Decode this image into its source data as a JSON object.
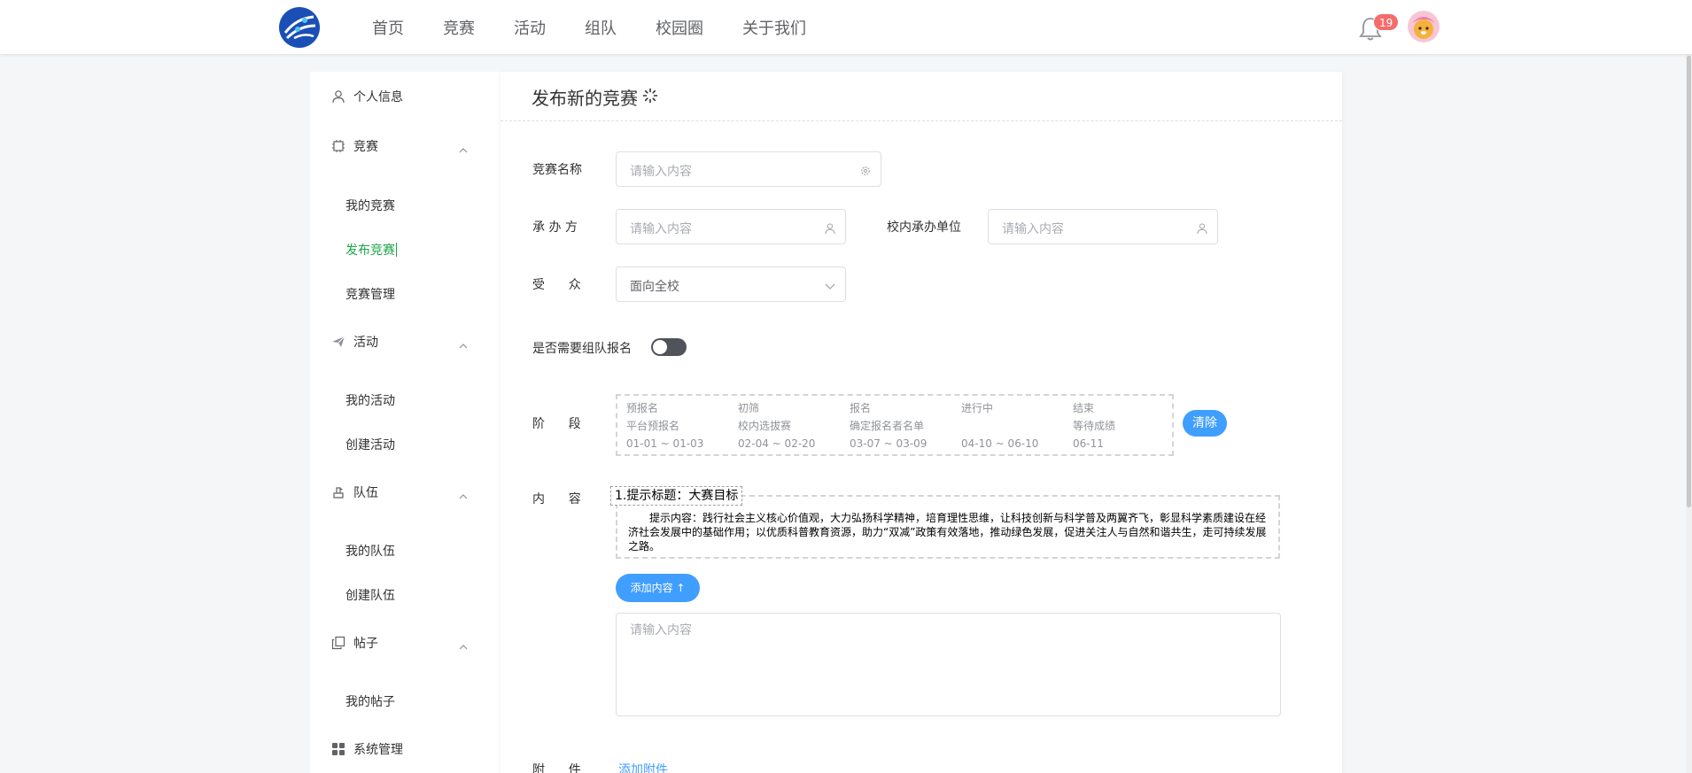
{
  "header": {
    "nav": [
      "首页",
      "竞赛",
      "活动",
      "组队",
      "校园圈",
      "关于我们"
    ],
    "notification_count": "19"
  },
  "sidebar": {
    "profile": "个人信息",
    "competition": {
      "label": "竞赛",
      "items": [
        "我的竞赛",
        "发布竞赛",
        "竞赛管理"
      ],
      "active": "发布竞赛"
    },
    "activity": {
      "label": "活动",
      "items": [
        "我的活动",
        "创建活动"
      ]
    },
    "team": {
      "label": "队伍",
      "items": [
        "我的队伍",
        "创建队伍"
      ]
    },
    "post": {
      "label": "帖子",
      "items": [
        "我的帖子"
      ]
    },
    "system": "系统管理"
  },
  "main": {
    "title": "发布新的竞赛",
    "form": {
      "name_label": "竞赛名称",
      "name_placeholder": "请输入内容",
      "organizer_label": "承 办 方",
      "organizer_placeholder": "请输入内容",
      "unit_label": "校内承办单位",
      "unit_placeholder": "请输入内容",
      "audience_label": "受      众",
      "audience_value": "面向全校",
      "team_label": "是否需要组队报名",
      "team_enabled": false,
      "stage_label": "阶      段",
      "stages": [
        {
          "name": "预报名",
          "desc": "平台预报名",
          "date": "01-01 ~ 01-03"
        },
        {
          "name": "初筛",
          "desc": "校内选拔赛",
          "date": "02-04 ~ 02-20"
        },
        {
          "name": "报名",
          "desc": "确定报名者名单",
          "date": "03-07 ~ 03-09"
        },
        {
          "name": "进行中",
          "desc": "",
          "date": "04-10 ~ 06-10"
        },
        {
          "name": "结束",
          "desc": "等待成绩",
          "date": "06-11"
        }
      ],
      "clear_label": "清除",
      "content_label": "内      容",
      "content_title": "1.提示标题：大赛目标",
      "content_text": "提示内容：践行社会主义核心价值观，大力弘扬科学精神，培育理性思维，让科技创新与科学普及两翼齐飞，彰显科学素质建设在经济社会发展中的基础作用；以优质科普教育资源，助力“双减”政策有效落地，推动绿色发展，促进关注人与自然和谐共生，走可持续发展之路。",
      "add_content_label": "添加内容 ↑",
      "textarea_placeholder": "请输入内容",
      "attach_label": "附      件",
      "attach_link": "添加附件"
    }
  },
  "colors": {
    "accent": "#409eff",
    "active_menu": "#1ea54a",
    "badge": "#f56c6c"
  }
}
